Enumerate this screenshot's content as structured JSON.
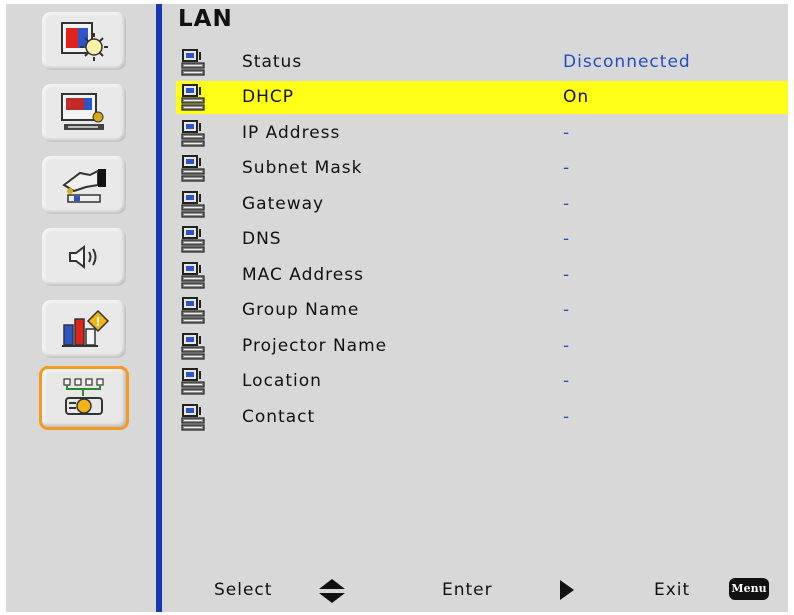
{
  "section_title": "LAN",
  "sidebar": {
    "items": [
      {
        "icon": "picture-settings-icon"
      },
      {
        "icon": "display-settings-icon"
      },
      {
        "icon": "setup-icon"
      },
      {
        "icon": "audio-icon"
      },
      {
        "icon": "info-icon"
      },
      {
        "icon": "lan-network-icon",
        "active": true
      }
    ]
  },
  "rows": [
    {
      "label": "Status",
      "value": "Disconnected"
    },
    {
      "label": "DHCP",
      "value": "On",
      "selected": true
    },
    {
      "label": "IP Address",
      "value": "-"
    },
    {
      "label": "Subnet Mask",
      "value": "-"
    },
    {
      "label": "Gateway",
      "value": "-"
    },
    {
      "label": "DNS",
      "value": "-"
    },
    {
      "label": "MAC Address",
      "value": "-"
    },
    {
      "label": "Group Name",
      "value": "-"
    },
    {
      "label": "Projector Name",
      "value": "-"
    },
    {
      "label": "Location",
      "value": "-"
    },
    {
      "label": "Contact",
      "value": "-"
    }
  ],
  "footer": {
    "select_label": "Select",
    "enter_label": "Enter",
    "exit_label": "Exit",
    "menu_key": "Menu"
  },
  "colors": {
    "highlight": "#ffff17",
    "value_text": "#1f4fc0",
    "divider": "#1738b4",
    "active_border": "#f39a1f"
  }
}
